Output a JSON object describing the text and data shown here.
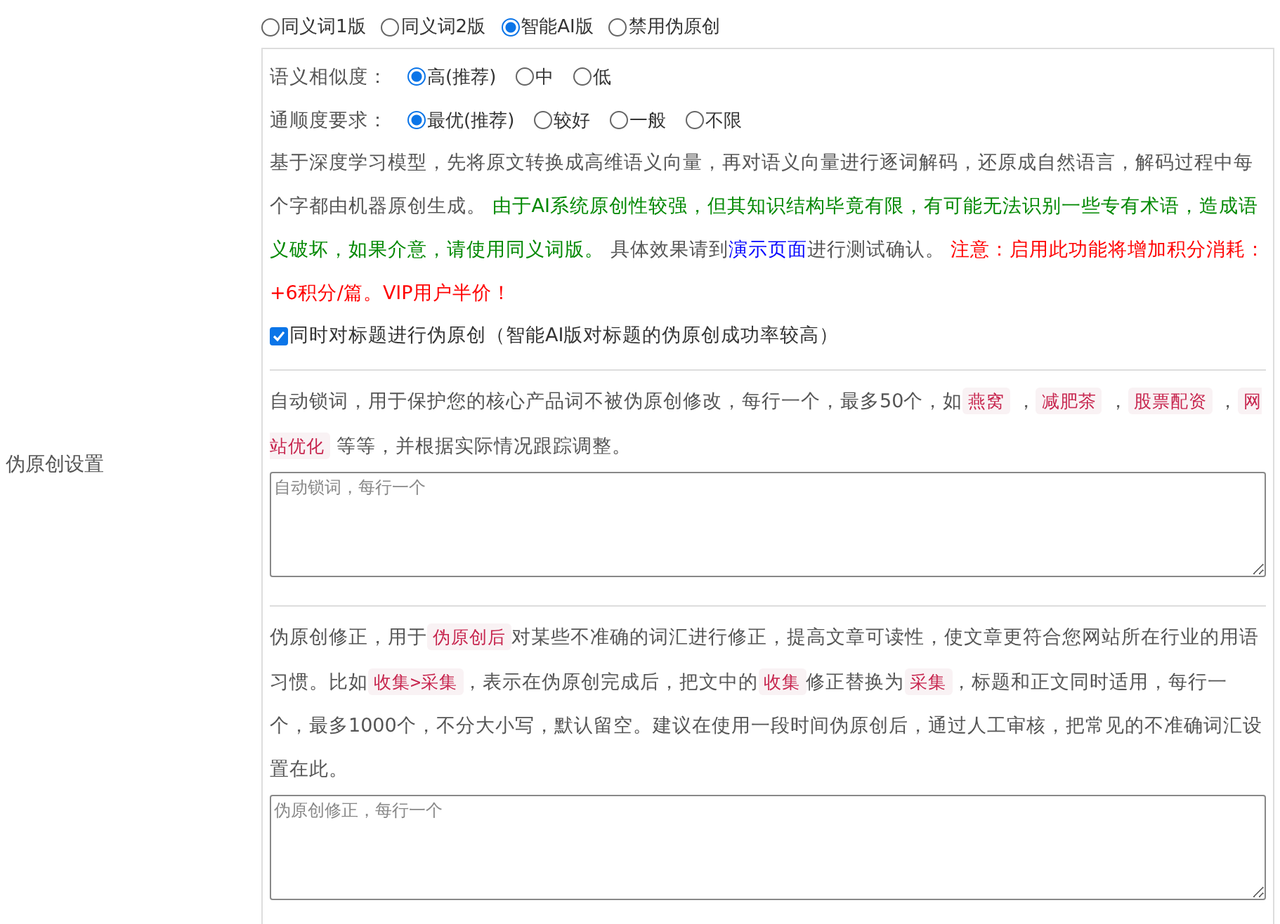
{
  "section_label": "伪原创设置",
  "mode_options": [
    {
      "label": "同义词1版",
      "selected": false
    },
    {
      "label": "同义词2版",
      "selected": false
    },
    {
      "label": "智能AI版",
      "selected": true
    },
    {
      "label": "禁用伪原创",
      "selected": false
    }
  ],
  "similarity": {
    "label": "语义相似度：",
    "options": [
      {
        "label": "高(推荐)",
        "selected": true
      },
      {
        "label": "中",
        "selected": false
      },
      {
        "label": "低",
        "selected": false
      }
    ]
  },
  "fluency": {
    "label": "通顺度要求：",
    "options": [
      {
        "label": "最优(推荐)",
        "selected": true
      },
      {
        "label": "较好",
        "selected": false
      },
      {
        "label": "一般",
        "selected": false
      },
      {
        "label": "不限",
        "selected": false
      }
    ]
  },
  "ai_description": [
    {
      "kind": "plain",
      "text": "基于深度学习模型，先将原文转换成高维语义向量，再对语义向量进行逐词解码，还原成自然语言，解码过程中每个字都由机器原创生成。 "
    },
    {
      "kind": "green",
      "text": "由于AI系统原创性较强，但其知识结构毕竟有限，有可能无法识别一些专有术语，造成语义破坏，如果介意，请使用同义词版。"
    },
    {
      "kind": "plain",
      "text": " 具体效果请到"
    },
    {
      "kind": "link",
      "text": "演示页面"
    },
    {
      "kind": "plain",
      "text": "进行测试确认。 "
    },
    {
      "kind": "red",
      "text": "注意：启用此功能将增加积分消耗：+6积分/篇。VIP用户半价！"
    }
  ],
  "title_checkbox": {
    "label": "同时对标题进行伪原创（智能AI版对标题的伪原创成功率较高）",
    "checked": true
  },
  "lock_words": {
    "description": [
      {
        "kind": "plain",
        "text": "自动锁词，用于保护您的核心产品词不被伪原创修改，每行一个，最多50个，如"
      },
      {
        "kind": "code",
        "text": "燕窝"
      },
      {
        "kind": "plain",
        "text": " ，"
      },
      {
        "kind": "code",
        "text": "减肥茶"
      },
      {
        "kind": "plain",
        "text": " ，"
      },
      {
        "kind": "code",
        "text": "股票配资"
      },
      {
        "kind": "plain",
        "text": " ，"
      },
      {
        "kind": "code",
        "text": "网站优化"
      },
      {
        "kind": "plain",
        "text": " 等等，并根据实际情况跟踪调整。"
      }
    ],
    "placeholder": "自动锁词，每行一个"
  },
  "correction": {
    "description": [
      {
        "kind": "plain",
        "text": "伪原创修正，用于"
      },
      {
        "kind": "code",
        "text": "伪原创后"
      },
      {
        "kind": "plain",
        "text": "对某些不准确的词汇进行修正，提高文章可读性，使文章更符合您网站所在行业的用语习惯。比如"
      },
      {
        "kind": "code",
        "text": "收集>采集"
      },
      {
        "kind": "plain",
        "text": "，表示在伪原创完成后，把文中的"
      },
      {
        "kind": "code",
        "text": "收集"
      },
      {
        "kind": "plain",
        "text": "修正替换为"
      },
      {
        "kind": "code",
        "text": "采集"
      },
      {
        "kind": "plain",
        "text": "，标题和正文同时适用，每行一个，最多1000个，不分大小写，默认留空。建议在使用一段时间伪原创后，通过人工审核，把常见的不准确词汇设置在此。"
      }
    ],
    "placeholder": "伪原创修正，每行一个"
  }
}
